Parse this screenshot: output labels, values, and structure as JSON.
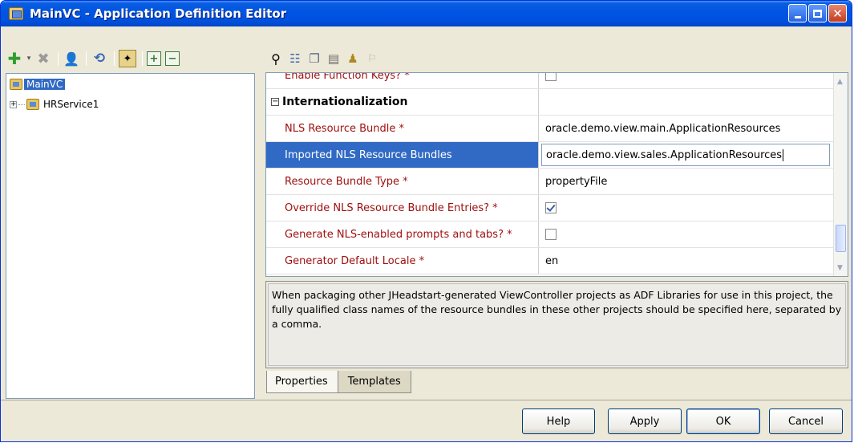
{
  "window": {
    "title": "MainVC - Application Definition Editor"
  },
  "tree": {
    "items": [
      {
        "label": "MainVC",
        "selected": true
      },
      {
        "label": "HRService1",
        "selected": false
      }
    ]
  },
  "property_grid": {
    "rows": [
      {
        "name": "Enable Function Keys? *",
        "value_type": "checkbox",
        "checked": false
      },
      {
        "section": "Internationalization"
      },
      {
        "name": "NLS Resource Bundle *",
        "value": "oracle.demo.view.main.ApplicationResources"
      },
      {
        "name": "Imported NLS Resource Bundles",
        "value": "oracle.demo.view.sales.ApplicationResources",
        "selected": true
      },
      {
        "name": "Resource Bundle Type *",
        "value": "propertyFile"
      },
      {
        "name": "Override NLS Resource Bundle Entries? *",
        "value_type": "checkbox",
        "checked": true
      },
      {
        "name": "Generate NLS-enabled prompts and tabs? *",
        "value_type": "checkbox",
        "checked": false
      },
      {
        "name": "Generator Default Locale *",
        "value": "en"
      }
    ]
  },
  "description": "When packaging other JHeadstart-generated ViewController projects as ADF Libraries for use in this project, the fully qualified class names of the resource bundles in these other projects should be specified here, separated by a comma.",
  "tabs": [
    {
      "label": "Properties",
      "active": true
    },
    {
      "label": "Templates",
      "active": false
    }
  ],
  "buttons": {
    "help": "Help",
    "apply": "Apply",
    "ok": "OK",
    "cancel": "Cancel"
  },
  "icons": {
    "toolbar_left": [
      "add-icon",
      "dropdown-arrow-icon",
      "delete-icon",
      "user-icon",
      "refresh-icon",
      "wizard-icon",
      "expand-icon",
      "collapse-icon"
    ],
    "toolbar_right": [
      "find-icon",
      "tree-view-icon",
      "copy-icon",
      "paste-icon",
      "lamp-icon",
      "pin-icon"
    ]
  },
  "colors": {
    "required_label": "#a01010",
    "selection": "#316ac5",
    "titlebar": "#0054e3"
  }
}
